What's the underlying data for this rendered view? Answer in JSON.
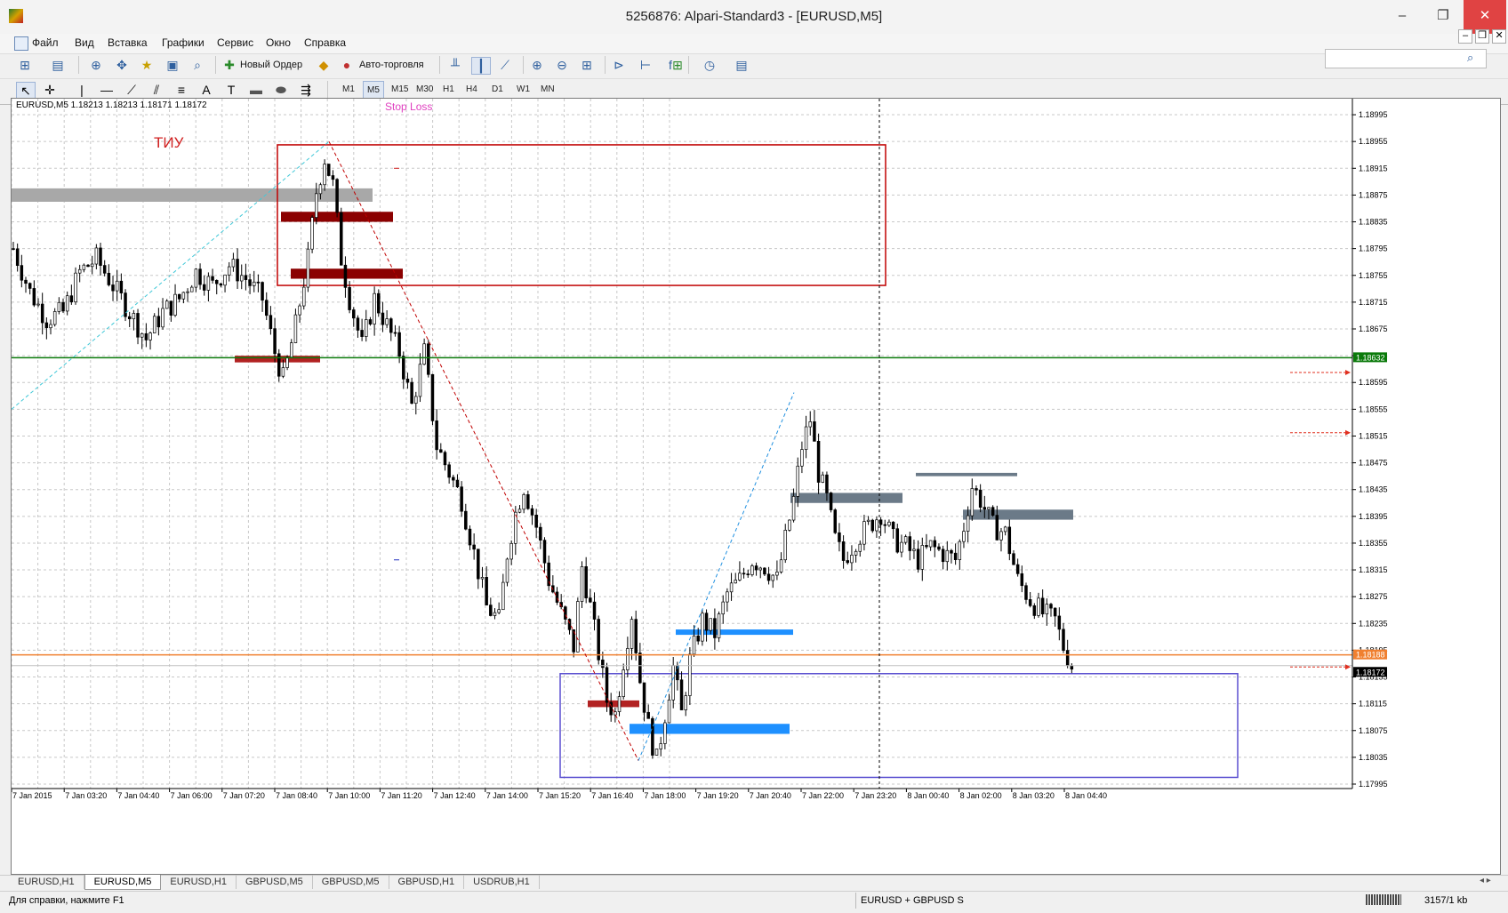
{
  "window": {
    "title": "5256876: Alpari-Standard3 - [EURUSD,M5]",
    "minimize": "–",
    "restore": "❐",
    "close": "✕"
  },
  "menu": [
    "Файл",
    "Вид",
    "Вставка",
    "Графики",
    "Сервис",
    "Окно",
    "Справка"
  ],
  "toolbar": {
    "new_order": "Новый Ордер",
    "autotrading": "Авто-торговля",
    "search_placeholder": ""
  },
  "timeframes": [
    "M1",
    "M5",
    "M15",
    "M30",
    "H1",
    "H4",
    "D1",
    "W1",
    "MN"
  ],
  "active_timeframe": "M5",
  "chart": {
    "info": "EURUSD,M5  1.18213 1.18213 1.18171 1.18172",
    "annotations": {
      "tiu": "ТИУ",
      "stop_loss": "Stop Loss"
    },
    "price_labels": {
      "green_line": "1.18632",
      "orange_line": "1.18188",
      "current": "1.18172"
    },
    "colors": {
      "background": "#ffffff",
      "grid": "#c8c8c8",
      "candles": "#000000",
      "green_line": "#0a7a0a",
      "orange_line": "#f08030",
      "red_zone": "#8b0000",
      "blue_zone": "#1e90ff",
      "slate_zone": "#6b7a88",
      "rect_red": "#c00000",
      "rect_blue": "#5a4fd0"
    }
  },
  "chart_data": {
    "type": "candlestick",
    "symbol": "EURUSD",
    "timeframe": "M5",
    "ylim": [
      1.17995,
      1.19015
    ],
    "y_ticks": [
      "1.18995",
      "1.18955",
      "1.18915",
      "1.18875",
      "1.18835",
      "1.18795",
      "1.18755",
      "1.18715",
      "1.18675",
      "1.18635",
      "1.18595",
      "1.18555",
      "1.18515",
      "1.18475",
      "1.18435",
      "1.18395",
      "1.18355",
      "1.18315",
      "1.18275",
      "1.18235",
      "1.18195",
      "1.18155",
      "1.18115",
      "1.18075",
      "1.18035",
      "1.17995"
    ],
    "x_ticks": [
      "7 Jan 2015",
      "7 Jan 03:20",
      "7 Jan 04:40",
      "7 Jan 06:00",
      "7 Jan 07:20",
      "7 Jan 08:40",
      "7 Jan 10:00",
      "7 Jan 11:20",
      "7 Jan 12:40",
      "7 Jan 14:00",
      "7 Jan 15:20",
      "7 Jan 16:40",
      "7 Jan 18:00",
      "7 Jan 19:20",
      "7 Jan 20:40",
      "7 Jan 22:00",
      "7 Jan 23:20",
      "8 Jan 00:40",
      "8 Jan 02:00",
      "8 Jan 03:20",
      "8 Jan 04:40"
    ],
    "close_path": [
      [
        0,
        1.18795
      ],
      [
        4,
        1.1873
      ],
      [
        8,
        1.1869
      ],
      [
        12,
        1.187
      ],
      [
        16,
        1.1876
      ],
      [
        20,
        1.1878
      ],
      [
        24,
        1.1874
      ],
      [
        28,
        1.187
      ],
      [
        32,
        1.1866
      ],
      [
        36,
        1.187
      ],
      [
        40,
        1.1872
      ],
      [
        44,
        1.1876
      ],
      [
        48,
        1.1874
      ],
      [
        52,
        1.1877
      ],
      [
        56,
        1.1875
      ],
      [
        60,
        1.1872
      ],
      [
        63,
        1.1864
      ],
      [
        65,
        1.186
      ],
      [
        68,
        1.1868
      ],
      [
        71,
        1.1878
      ],
      [
        73,
        1.1888
      ],
      [
        75,
        1.1893
      ],
      [
        77,
        1.1889
      ],
      [
        79,
        1.1878
      ],
      [
        81,
        1.1872
      ],
      [
        84,
        1.1865
      ],
      [
        87,
        1.1872
      ],
      [
        90,
        1.1868
      ],
      [
        93,
        1.1864
      ],
      [
        96,
        1.1856
      ],
      [
        99,
        1.1864
      ],
      [
        102,
        1.185
      ],
      [
        105,
        1.1846
      ],
      [
        108,
        1.1842
      ],
      [
        111,
        1.1834
      ],
      [
        114,
        1.1826
      ],
      [
        117,
        1.1824
      ],
      [
        119,
        1.1834
      ],
      [
        121,
        1.184
      ],
      [
        123,
        1.1844
      ],
      [
        126,
        1.1838
      ],
      [
        129,
        1.183
      ],
      [
        132,
        1.1825
      ],
      [
        135,
        1.182
      ],
      [
        137,
        1.1832
      ],
      [
        139,
        1.1826
      ],
      [
        141,
        1.1819
      ],
      [
        143,
        1.1812
      ],
      [
        145,
        1.181
      ],
      [
        147,
        1.1818
      ],
      [
        149,
        1.1825
      ],
      [
        151,
        1.1815
      ],
      [
        153,
        1.1808
      ],
      [
        155,
        1.1803
      ],
      [
        157,
        1.181
      ],
      [
        159,
        1.1817
      ],
      [
        161,
        1.181
      ],
      [
        163,
        1.1818
      ],
      [
        166,
        1.1824
      ],
      [
        169,
        1.1822
      ],
      [
        172,
        1.1828
      ],
      [
        175,
        1.183
      ],
      [
        178,
        1.1833
      ],
      [
        181,
        1.1832
      ],
      [
        184,
        1.183
      ],
      [
        186,
        1.1836
      ],
      [
        188,
        1.1842
      ],
      [
        190,
        1.185
      ],
      [
        192,
        1.1854
      ],
      [
        194,
        1.1846
      ],
      [
        196,
        1.1842
      ],
      [
        198,
        1.1836
      ],
      [
        200,
        1.1833
      ],
      [
        203,
        1.1836
      ],
      [
        206,
        1.1838
      ],
      [
        209,
        1.184
      ],
      [
        212,
        1.1836
      ],
      [
        215,
        1.1835
      ],
      [
        218,
        1.1833
      ],
      [
        221,
        1.1835
      ],
      [
        224,
        1.1834
      ],
      [
        227,
        1.1833
      ],
      [
        229,
        1.1838
      ],
      [
        231,
        1.1844
      ],
      [
        233,
        1.1842
      ],
      [
        236,
        1.1838
      ],
      [
        239,
        1.1837
      ],
      [
        242,
        1.183
      ],
      [
        245,
        1.1827
      ],
      [
        248,
        1.1825
      ],
      [
        251,
        1.1824
      ],
      [
        253,
        1.182
      ],
      [
        255,
        1.18172
      ]
    ],
    "horizontal_lines": [
      {
        "price": 1.18632,
        "name": "green-line"
      },
      {
        "price": 1.18188,
        "name": "orange-line"
      }
    ]
  },
  "tabs": [
    "EURUSD,H1",
    "EURUSD,M5",
    "EURUSD,H1",
    "GBPUSD,M5",
    "GBPUSD,M5",
    "GBPUSD,H1",
    "USDRUB,H1"
  ],
  "active_tab_index": 1,
  "status": {
    "help": "Для справки, нажмите F1",
    "symbols": "EURUSD + GBPUSD S",
    "traffic": "3157/1 kb"
  }
}
